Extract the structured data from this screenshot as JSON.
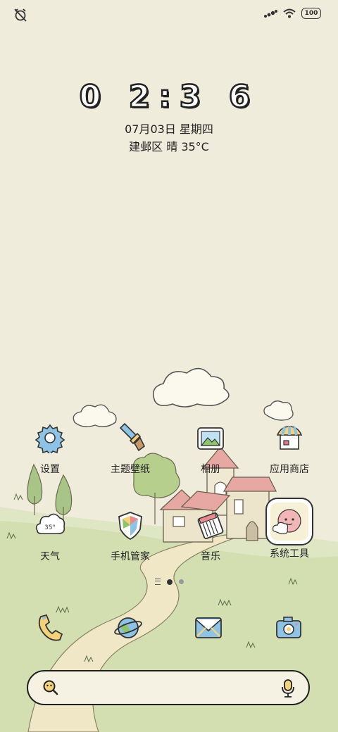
{
  "status": {
    "battery": "100",
    "left_icon": "alarm-off-icon",
    "right_icons": [
      "signal-icon",
      "wifi-icon",
      "battery-icon"
    ]
  },
  "clock": {
    "time": "0 2:3 6"
  },
  "date": {
    "text": "07月03日 星期四"
  },
  "weather": {
    "text": "建邺区 晴 35°C"
  },
  "apps_row1": [
    {
      "label": "设置",
      "icon": "gear-icon"
    },
    {
      "label": "主题壁纸",
      "icon": "paintbrush-icon"
    },
    {
      "label": "相册",
      "icon": "gallery-icon"
    },
    {
      "label": "应用商店",
      "icon": "store-icon"
    }
  ],
  "apps_row2": [
    {
      "label": "天气",
      "icon": "cloud-icon",
      "badge": "35°"
    },
    {
      "label": "手机管家",
      "icon": "shield-icon"
    },
    {
      "label": "音乐",
      "icon": "piano-icon"
    },
    {
      "label": "系统工具",
      "icon": "folder-icon"
    }
  ],
  "dock": [
    {
      "icon": "phone-icon"
    },
    {
      "icon": "browser-planet-icon"
    },
    {
      "icon": "message-envelope-icon"
    },
    {
      "icon": "camera-icon"
    }
  ],
  "search": {
    "left_icon": "search-icon",
    "right_icon": "microphone-icon"
  },
  "colors": {
    "background": "#f0ecdc",
    "grass": "#c9d9a3",
    "path": "#ece4c2",
    "roof": "#e8a7a4",
    "gear": "#8ec3e6"
  }
}
